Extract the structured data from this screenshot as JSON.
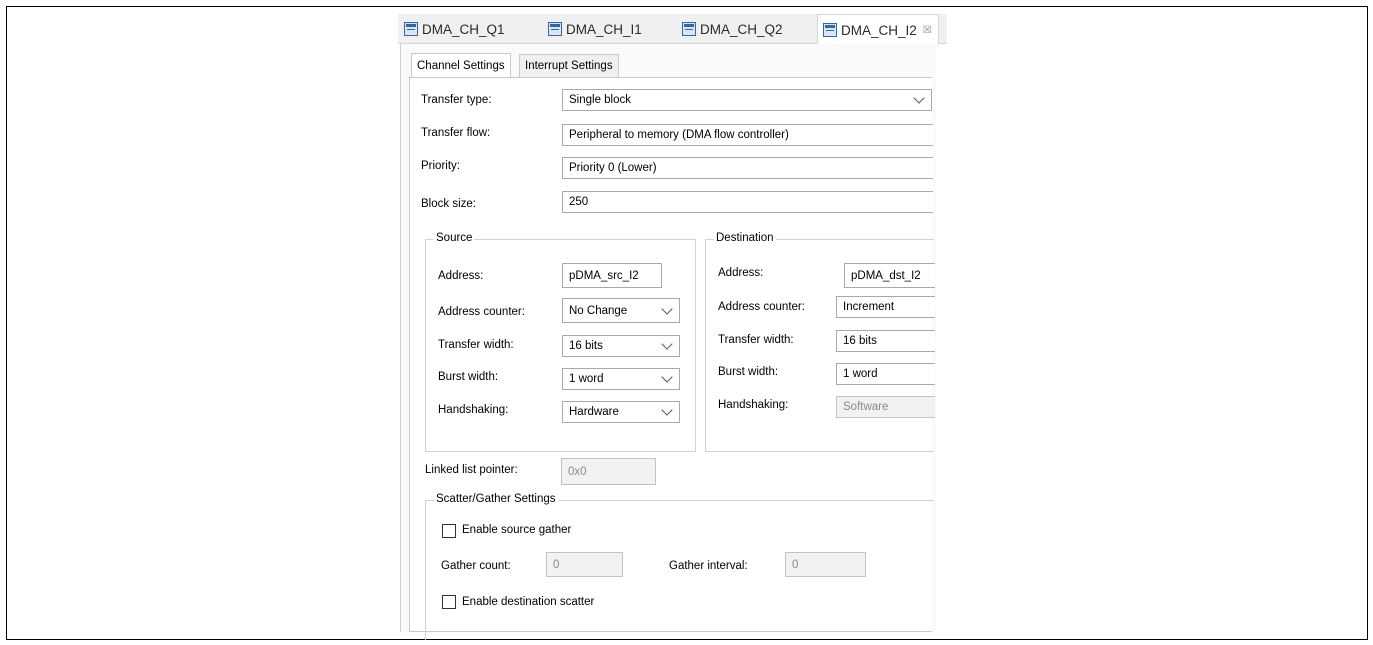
{
  "editor_tabs": [
    {
      "label": "DMA_CH_Q1"
    },
    {
      "label": "DMA_CH_I1"
    },
    {
      "label": "DMA_CH_Q2"
    },
    {
      "label": "DMA_CH_I2",
      "close": "☒"
    }
  ],
  "settings_tabs": [
    "Channel Settings",
    "Interrupt Settings"
  ],
  "channel": {
    "transfer_type_label": "Transfer type:",
    "transfer_type": "Single block",
    "transfer_flow_label": "Transfer flow:",
    "transfer_flow": "Peripheral to memory (DMA flow controller)",
    "priority_label": "Priority:",
    "priority": "Priority 0 (Lower)",
    "block_size_label": "Block size:",
    "block_size": "250"
  },
  "source": {
    "title": "Source",
    "address_label": "Address:",
    "address": "pDMA_src_I2",
    "counter_label": "Address counter:",
    "counter": "No Change",
    "width_label": "Transfer width:",
    "width": "16 bits",
    "burst_label": "Burst width:",
    "burst": "1 word",
    "handshake_label": "Handshaking:",
    "handshake": "Hardware"
  },
  "destination": {
    "title": "Destination",
    "address_label": "Address:",
    "address": "pDMA_dst_I2",
    "counter_label": "Address counter:",
    "counter": "Increment",
    "width_label": "Transfer width:",
    "width": "16 bits",
    "burst_label": "Burst width:",
    "burst": "1 word",
    "handshake_label": "Handshaking:",
    "handshake": "Software"
  },
  "linked_list": {
    "label": "Linked list pointer:",
    "value": "0x0"
  },
  "scatter_gather": {
    "title": "Scatter/Gather Settings",
    "enable_gather_label": "Enable source gather",
    "gather_count_label": "Gather count:",
    "gather_count": "0",
    "gather_interval_label": "Gather interval:",
    "gather_interval": "0",
    "enable_scatter_label": "Enable destination scatter"
  }
}
